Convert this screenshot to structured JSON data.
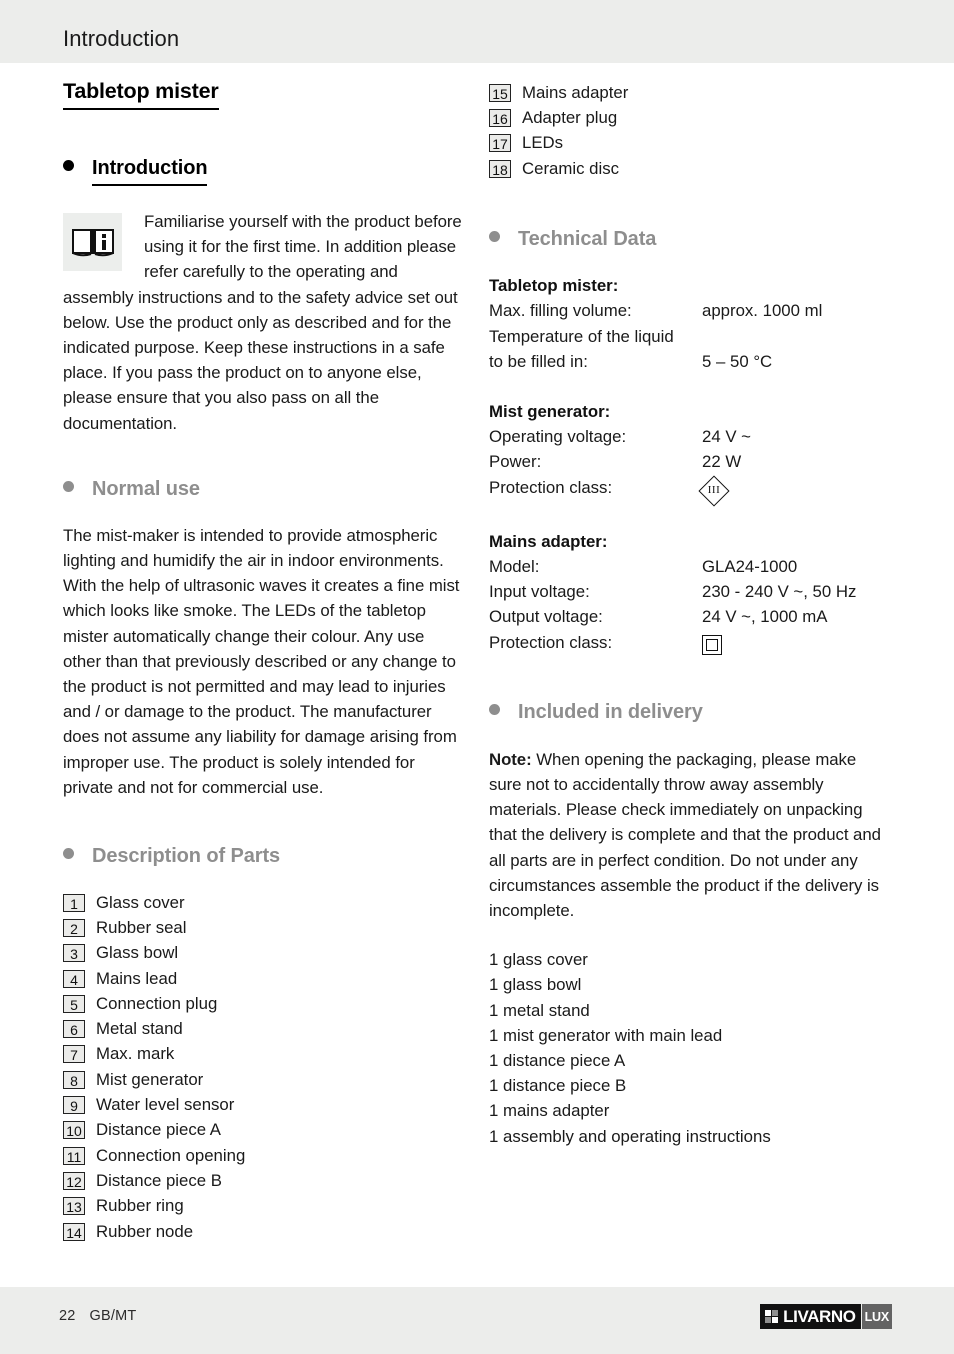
{
  "header": {
    "running_title": "Introduction"
  },
  "document": {
    "title": "Tabletop mister"
  },
  "left_column": {
    "intro_section": {
      "bullet": "bullet",
      "heading": "Introduction",
      "icon_name": "read-manual-icon",
      "paragraph": "Familiarise yourself with the product before using it for the first time. In addition please refer carefully to the operating and assembly instructions and to the safety advice set out below. Use the product only as described and for the indicated purpose. Keep these instructions in a safe place. If you pass the product on to anyone else, please ensure that you also pass on all the documentation."
    },
    "normal_use_section": {
      "heading": "Normal use",
      "paragraph": "The mist-maker is intended to provide atmospheric lighting and humidify the air in indoor environments. With the help of ultrasonic waves it creates a fine mist which looks like smoke. The LEDs of the tabletop mister automatically change their colour. Any use other than that previously described or any change to the product is not permitted and may lead to injuries and / or damage to the product. The manufacturer does not assume any liability for damage arising from improper use. The product is solely intended for private and not for commercial use."
    },
    "parts_section": {
      "heading": "Description of Parts",
      "parts": [
        {
          "num": "1",
          "label": "Glass cover"
        },
        {
          "num": "2",
          "label": "Rubber seal"
        },
        {
          "num": "3",
          "label": "Glass bowl"
        },
        {
          "num": "4",
          "label": "Mains lead"
        },
        {
          "num": "5",
          "label": "Connection plug"
        },
        {
          "num": "6",
          "label": "Metal stand"
        },
        {
          "num": "7",
          "label": "Max. mark"
        },
        {
          "num": "8",
          "label": "Mist generator"
        },
        {
          "num": "9",
          "label": "Water level sensor"
        },
        {
          "num": "10",
          "label": "Distance piece A"
        },
        {
          "num": "11",
          "label": "Connection opening"
        },
        {
          "num": "12",
          "label": "Distance piece B"
        },
        {
          "num": "13",
          "label": "Rubber ring"
        },
        {
          "num": "14",
          "label": "Rubber node"
        }
      ]
    }
  },
  "right_column": {
    "parts_continued": [
      {
        "num": "15",
        "label": "Mains adapter"
      },
      {
        "num": "16",
        "label": "Adapter plug"
      },
      {
        "num": "17",
        "label": "LEDs"
      },
      {
        "num": "18",
        "label": "Ceramic disc"
      }
    ],
    "technical_data": {
      "heading": "Technical Data",
      "groups": [
        {
          "title": "Tabletop mister:",
          "rows": [
            {
              "key": "Max. filling volume:",
              "value": "approx. 1000 ml"
            },
            {
              "key": "Temperature of the liquid",
              "value": ""
            },
            {
              "key": "to be filled in:",
              "value": "5 – 50 °C"
            }
          ]
        },
        {
          "title": "Mist generator:",
          "rows": [
            {
              "key": "Operating voltage:",
              "value": "24 V ~"
            },
            {
              "key": "Power:",
              "value": "22 W"
            },
            {
              "key": "Protection class:",
              "value": "",
              "symbol": "class-III-diamond",
              "symbol_text": "III"
            }
          ]
        },
        {
          "title": "Mains adapter:",
          "rows": [
            {
              "key": "Model:",
              "value": "GLA24-1000"
            },
            {
              "key": "Input voltage:",
              "value": "230 - 240 V ~, 50 Hz"
            },
            {
              "key": "Output voltage:",
              "value": "24 V ~, 1000 mA"
            },
            {
              "key": "Protection class:",
              "value": "",
              "symbol": "class-II-double-square"
            }
          ]
        }
      ]
    },
    "delivery": {
      "heading": "Included in delivery",
      "note_label": "Note:",
      "note_text": " When opening the packaging, please make sure not to accidentally throw away assembly materials. Please check immediately on unpacking that the delivery is complete and that the product and all parts are in perfect condition. Do not under any circumstances assemble the product if the delivery is incomplete.",
      "items": [
        "1 glass cover",
        "1 glass bowl",
        "1 metal stand",
        "1 mist generator with main lead",
        "1 distance piece A",
        "1 distance piece B",
        "1 mains adapter",
        "1 assembly and operating instructions"
      ]
    }
  },
  "footer": {
    "page_number": "22",
    "language_code": "GB/MT",
    "logo_word": "LIVARNO",
    "logo_suffix": "LUX"
  },
  "colors": {
    "band": "#ecedeb",
    "gray_heading": "#8e8e8e",
    "text": "#1a1a1a",
    "logo_dark": "#111111",
    "logo_gray": "#636363"
  }
}
